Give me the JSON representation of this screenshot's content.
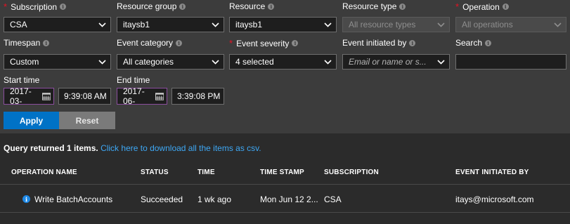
{
  "filters": {
    "subscription": {
      "label": "Subscription",
      "value": "CSA"
    },
    "resource_group": {
      "label": "Resource group",
      "value": "itaysb1"
    },
    "resource": {
      "label": "Resource",
      "value": "itaysb1"
    },
    "resource_type": {
      "label": "Resource type",
      "placeholder": "All resource types"
    },
    "operation": {
      "label": "Operation",
      "placeholder": "All operations"
    },
    "timespan": {
      "label": "Timespan",
      "value": "Custom"
    },
    "event_category": {
      "label": "Event category",
      "value": "All categories"
    },
    "event_severity": {
      "label": "Event severity",
      "value": "4 selected"
    },
    "event_initiated_by": {
      "label": "Event initiated by",
      "placeholder": "Email or name or s..."
    },
    "search": {
      "label": "Search",
      "value": ""
    },
    "start_time": {
      "label": "Start time",
      "date": "2017-03-",
      "time": "9:39:08 AM"
    },
    "end_time": {
      "label": "End time",
      "date": "2017-06-",
      "time": "3:39:08 PM"
    },
    "required_mark": "*",
    "info_glyph": "i"
  },
  "buttons": {
    "apply": "Apply",
    "reset": "Reset"
  },
  "query": {
    "result_text": "Query returned 1 items.",
    "download_link": "Click here to download all the items as csv."
  },
  "table": {
    "headers": [
      "OPERATION NAME",
      "STATUS",
      "TIME",
      "TIME STAMP",
      "SUBSCRIPTION",
      "EVENT INITIATED BY"
    ],
    "rows": [
      {
        "operation_name": "Write BatchAccounts",
        "status": "Succeeded",
        "time": "1 wk ago",
        "time_stamp": "Mon Jun 12 2...",
        "subscription": "CSA",
        "initiated_by": "itays@microsoft.com",
        "icon": "info-icon"
      }
    ]
  },
  "colors": {
    "panel_bg": "#3c3c3c",
    "page_bg": "#2b2b2b",
    "accent": "#0072c6",
    "link": "#3ea8f5",
    "required": "#e81123",
    "date_border": "#8b4e9e"
  }
}
